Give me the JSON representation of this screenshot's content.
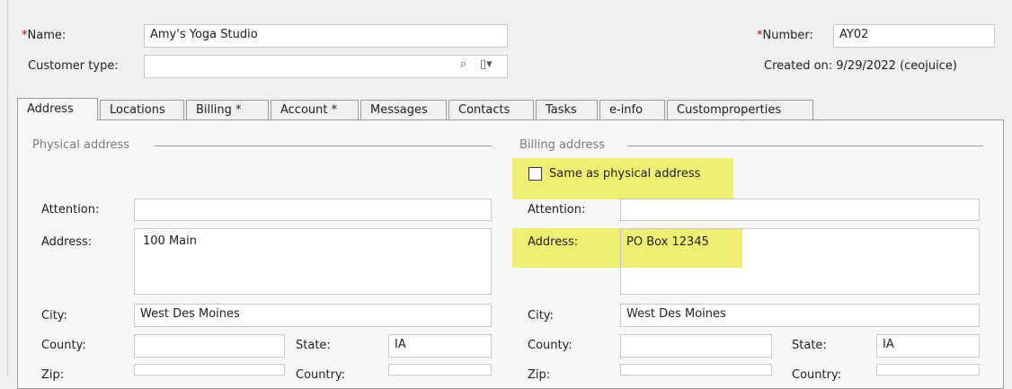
{
  "header": {
    "name_label": "Name:",
    "name_value": "Amy's Yoga Studio",
    "number_label": "Number:",
    "number_value": "AY02",
    "required_mark": "*",
    "customer_type_label": "Customer type:",
    "customer_type_value": "",
    "created_on": "Created on: 9/29/2022 (ceojuice)"
  },
  "tabs": [
    {
      "label": "Address"
    },
    {
      "label": "Locations"
    },
    {
      "label": "Billing *"
    },
    {
      "label": "Account *"
    },
    {
      "label": "Messages"
    },
    {
      "label": "Contacts"
    },
    {
      "label": "Tasks"
    },
    {
      "label": "e-info"
    },
    {
      "label": "Customproperties"
    }
  ],
  "physical": {
    "section_title": "Physical address",
    "attention_label": "Attention:",
    "attention_value": "",
    "address_label": "Address:",
    "address_value": "100 Main",
    "city_label": "City:",
    "city_value": "West Des Moines",
    "county_label": "County:",
    "county_value": "",
    "state_label": "State:",
    "state_value": "IA",
    "zip_label": "Zip:",
    "country_label": "Country:"
  },
  "billing": {
    "section_title": "Billing address",
    "same_as_label": "Same as physical address",
    "same_as_checked": false,
    "attention_label": "Attention:",
    "attention_value": "",
    "address_label": "Address:",
    "address_value": "PO Box 12345",
    "city_label": "City:",
    "city_value": "West Des Moines",
    "county_label": "County:",
    "county_value": "",
    "state_label": "State:",
    "state_value": "IA",
    "zip_label": "Zip:",
    "country_label": "Country:"
  },
  "colors": {
    "highlight": "#ecec5a",
    "required": "#d40000"
  }
}
